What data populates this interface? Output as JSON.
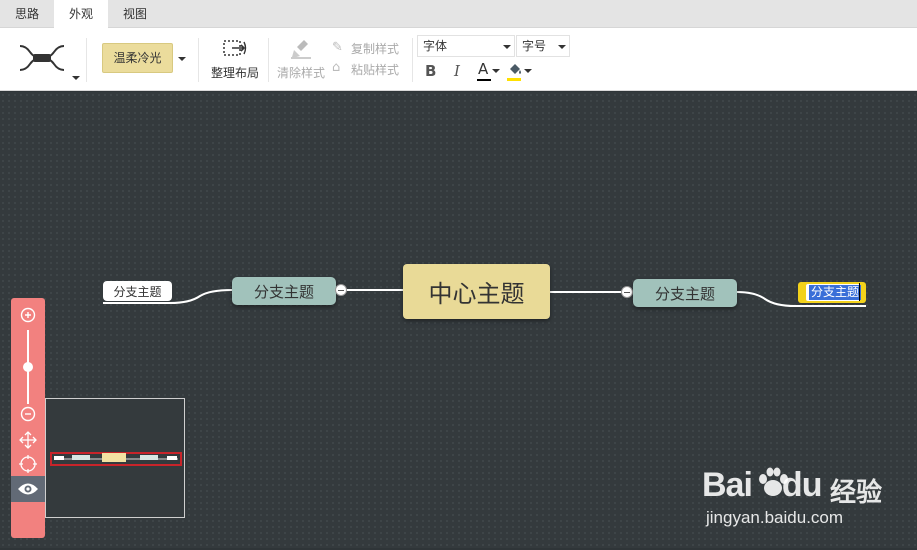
{
  "tabs": [
    {
      "label": "思路",
      "active": false
    },
    {
      "label": "外观",
      "active": true
    },
    {
      "label": "视图",
      "active": false
    }
  ],
  "ribbon": {
    "structure_icon": "mindmap-structure-icon",
    "theme_label": "温柔冷光",
    "arrange_label": "整理布局",
    "clear_style_label": "清除样式",
    "copy_style_label": "复制样式",
    "paste_style_label": "粘贴样式",
    "font_select_value": "字体",
    "size_select_value": "字号",
    "bold_label": "B",
    "italic_label": "I",
    "font_color_label": "A",
    "font_color": "#000000",
    "fill_color": "#ffe000"
  },
  "map": {
    "center": "中心主题",
    "left_branch": "分支主题",
    "left_sub": "分支主题",
    "right_branch": "分支主题",
    "right_sub_selected": "分支主题"
  },
  "zoom": {
    "level": 0.5
  },
  "watermark": {
    "brand_bai": "Bai",
    "brand_du": "du",
    "brand_cn": "经验",
    "url": "jingyan.baidu.com"
  },
  "colors": {
    "canvas": "#343a3d",
    "center_node": "#e9da97",
    "branch_node": "#a1c2bb",
    "zoom_panel": "#f2817f",
    "selected_outline": "#f3d21b",
    "selection_highlight": "#3a6fd8"
  }
}
